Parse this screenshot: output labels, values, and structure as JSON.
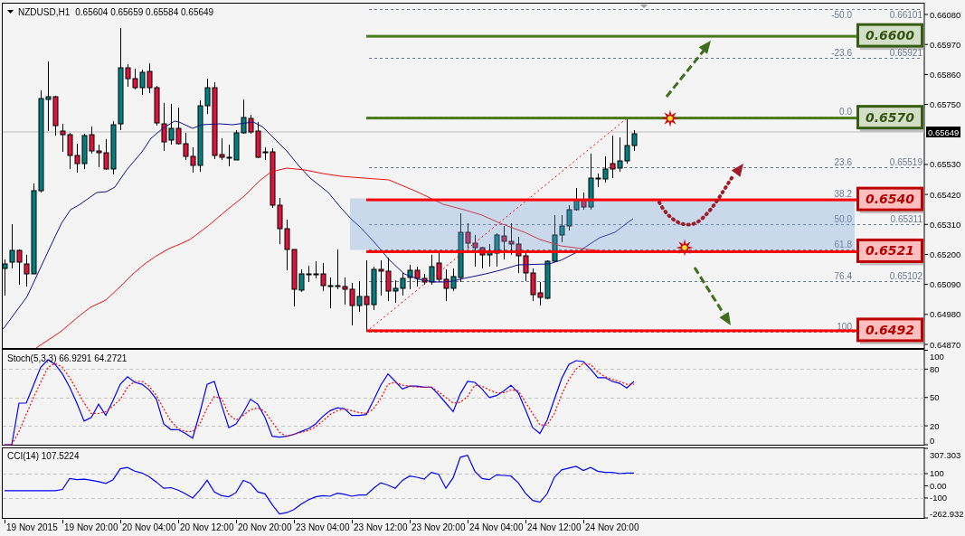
{
  "chart": {
    "symbol": "NZDUSD,H1",
    "quote": "0.65604 0.65659 0.65584 0.65649",
    "price_axis": [
      "0.66080",
      "0.65970",
      "0.65860",
      "0.65750",
      "0.65530",
      "0.65420",
      "0.65310",
      "0.65200",
      "0.65090",
      "0.64980",
      "0.64870"
    ],
    "current_price": "0.65649",
    "fibonacci": [
      {
        "level": "-50.0",
        "price": "0.66101"
      },
      {
        "level": "-23.6",
        "price": "0.65921"
      },
      {
        "level": "0.0"
      },
      {
        "level": "23.6",
        "price": "0.65519"
      },
      {
        "level": "38.2"
      },
      {
        "level": "50.0",
        "price": "0.65311"
      },
      {
        "level": "61.8"
      },
      {
        "level": "76.4",
        "price": "0.65102"
      },
      {
        "level": "100"
      }
    ],
    "levels": [
      {
        "label": "0.6600",
        "color": "#4a7a1a"
      },
      {
        "label": "0.6570",
        "color": "#4a7a1a"
      },
      {
        "label": "0.6540",
        "color": "#ff0000"
      },
      {
        "label": "0.6521",
        "color": "#ff0000"
      },
      {
        "label": "0.6492",
        "color": "#ff0000"
      }
    ]
  },
  "stochastic": {
    "chart_data": {
      "type": "line",
      "title": "Stoch(5,3,3) 66.9291 64.2721",
      "ylim": [
        0,
        100
      ],
      "yticks": [
        0,
        20,
        50,
        80,
        100
      ],
      "grid": true,
      "series": [
        {
          "color": "#0000ff",
          "line_style": "solid",
          "values": [
            0,
            0,
            44,
            44,
            63,
            82,
            90,
            85,
            75,
            61,
            44,
            25,
            29,
            43,
            31,
            47,
            64,
            72,
            66,
            64,
            58,
            48,
            22,
            16,
            16,
            12,
            7,
            34,
            64,
            67,
            42,
            18,
            22,
            34,
            48,
            43,
            29,
            9,
            8,
            9,
            11,
            14,
            17,
            22,
            30,
            36,
            39,
            38,
            31,
            31,
            32,
            47,
            63,
            75,
            67,
            59,
            62,
            62,
            61,
            61,
            53,
            44,
            35,
            54,
            67,
            66,
            59,
            50,
            52,
            57,
            63,
            55,
            37,
            18,
            12,
            26,
            48,
            70,
            85,
            89,
            88,
            80,
            71,
            71,
            67,
            65,
            60,
            67
          ]
        },
        {
          "color": "#ff0000",
          "line_style": "dashed",
          "values": [
            0,
            0,
            14,
            32,
            50,
            66,
            82,
            86,
            82,
            71,
            58,
            44,
            33,
            33,
            35,
            41,
            48,
            61,
            67,
            67,
            62,
            52,
            38,
            25,
            17,
            14,
            14,
            22,
            39,
            51,
            49,
            32,
            26,
            31,
            37,
            39,
            35,
            24,
            13,
            9,
            11,
            13,
            15,
            19,
            25,
            32,
            36,
            38,
            36,
            34,
            33,
            38,
            49,
            64,
            66,
            63,
            62,
            61,
            61,
            61,
            56,
            50,
            44,
            45,
            51,
            63,
            62,
            58,
            55,
            55,
            58,
            57,
            45,
            33,
            21,
            21,
            33,
            53,
            69,
            80,
            86,
            85,
            77,
            72,
            69,
            67,
            64,
            64
          ]
        }
      ]
    }
  },
  "cci": {
    "chart_data": {
      "type": "line",
      "title": "CCI(14) 107.5224",
      "ylim": [
        -262.9323,
        307.303
      ],
      "yticks": [
        {
          "value": -262.9323,
          "label": "-262.932"
        },
        {
          "value": -100,
          "label": "-100"
        },
        {
          "value": 0,
          "label": "0.00"
        },
        {
          "value": 100,
          "label": "100"
        },
        {
          "value": 307.303,
          "label": "307.303"
        }
      ],
      "grid": true,
      "series": [
        {
          "color": "#0000ff",
          "line_style": "solid",
          "values": [
            -40,
            -40,
            -40,
            -40,
            -40,
            -40,
            -40,
            -40,
            -30,
            60,
            50,
            55,
            45,
            35,
            20,
            50,
            140,
            150,
            120,
            105,
            75,
            30,
            -20,
            -15,
            -35,
            -65,
            -100,
            -35,
            45,
            -50,
            -80,
            -90,
            -55,
            45,
            20,
            -50,
            -65,
            -155,
            -230,
            -220,
            -195,
            -150,
            -115,
            -90,
            -80,
            -85,
            -60,
            -70,
            -85,
            -75,
            -75,
            -20,
            25,
            5,
            -20,
            45,
            80,
            70,
            55,
            110,
            95,
            -20,
            65,
            235,
            250,
            120,
            60,
            50,
            90,
            85,
            80,
            25,
            -60,
            -120,
            -135,
            -65,
            70,
            130,
            145,
            160,
            125,
            150,
            120,
            110,
            110,
            100,
            105,
            105
          ]
        }
      ]
    }
  },
  "time_axis": [
    "19 Nov 2015",
    "19 Nov 20:00",
    "20 Nov 04:00",
    "20 Nov 12:00",
    "20 Nov 20:00",
    "23 Nov 04:00",
    "23 Nov 12:00",
    "23 Nov 20:00",
    "24 Nov 04:00",
    "24 Nov 12:00",
    "24 Nov 20:00"
  ]
}
